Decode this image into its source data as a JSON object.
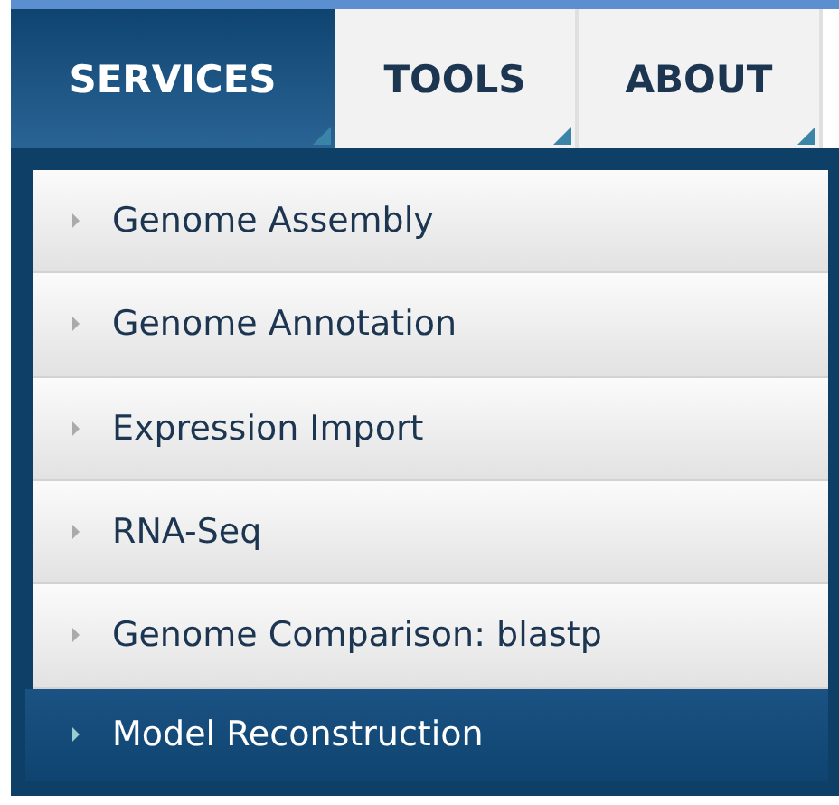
{
  "tabs": [
    {
      "label": "SERVICES",
      "selected": true
    },
    {
      "label": "TOOLS",
      "selected": false
    },
    {
      "label": "ABOUT",
      "selected": false
    }
  ],
  "menu": {
    "items": [
      {
        "label": "Genome Assembly",
        "selected": false
      },
      {
        "label": "Genome Annotation",
        "selected": false
      },
      {
        "label": "Expression Import",
        "selected": false
      },
      {
        "label": "RNA-Seq",
        "selected": false
      },
      {
        "label": "Genome Comparison: blastp",
        "selected": false
      },
      {
        "label": "Model Reconstruction",
        "selected": true
      }
    ]
  }
}
